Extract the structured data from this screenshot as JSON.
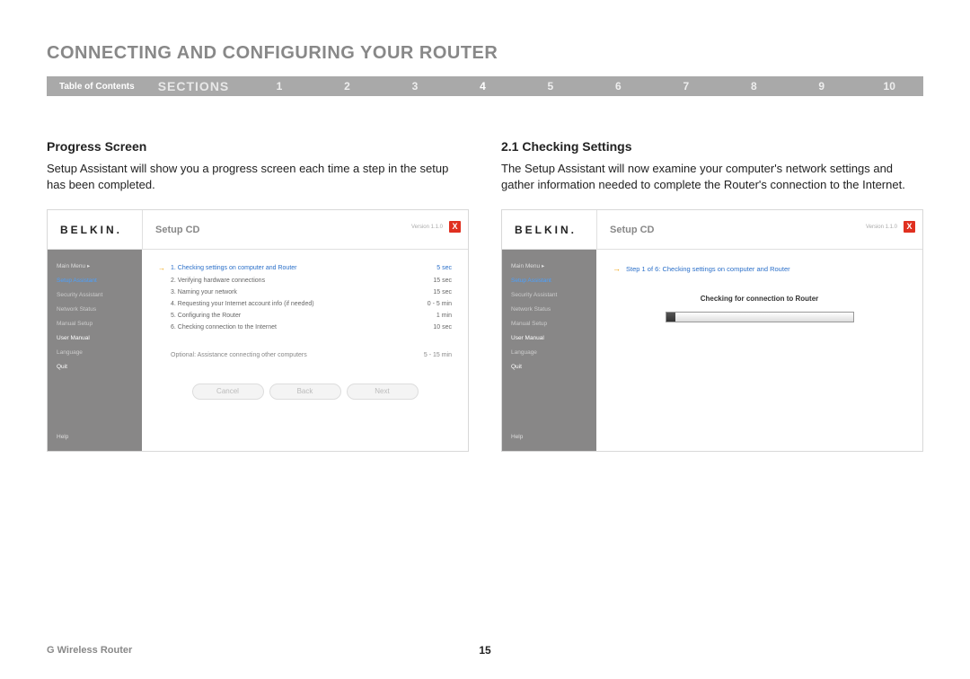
{
  "title": "CONNECTING AND CONFIGURING YOUR ROUTER",
  "navbar": {
    "toc": "Table of Contents",
    "sections": "SECTIONS",
    "nums": [
      "1",
      "2",
      "3",
      "4",
      "5",
      "6",
      "7",
      "8",
      "9",
      "10"
    ],
    "active": "4"
  },
  "left": {
    "heading": "Progress Screen",
    "body": "Setup Assistant will show you a progress screen each time a step in the setup has been completed."
  },
  "right": {
    "heading": "2.1 Checking Settings",
    "body": "The Setup Assistant will now examine your computer's network settings and gather information needed to complete the Router's connection to the Internet."
  },
  "screenshot": {
    "logo": "BELKIN.",
    "setupcd": "Setup CD",
    "version": "Version 1.1.0",
    "close": "X",
    "sidebar": {
      "main": "Main Menu  ▸",
      "items": [
        "Setup Assistant",
        "Security Assistant",
        "Network Status",
        "Manual Setup",
        "User Manual",
        "Language",
        "Quit"
      ],
      "help": "Help"
    },
    "steps": [
      {
        "n": "1.",
        "txt": "Checking settings on computer and Router",
        "time": "5 sec",
        "active": true
      },
      {
        "n": "2.",
        "txt": "Verifying hardware connections",
        "time": "15 sec"
      },
      {
        "n": "3.",
        "txt": "Naming your network",
        "time": "15 sec"
      },
      {
        "n": "4.",
        "txt": "Requesting your Internet account info (if needed)",
        "time": "0 - 5 min"
      },
      {
        "n": "5.",
        "txt": "Configuring the Router",
        "time": "1 min"
      },
      {
        "n": "6.",
        "txt": "Checking connection to the Internet",
        "time": "10 sec"
      }
    ],
    "optional": {
      "txt": "Optional: Assistance connecting other computers",
      "time": "5 - 15 min"
    },
    "buttons": {
      "cancel": "Cancel",
      "back": "Back",
      "next": "Next"
    }
  },
  "screenshot2": {
    "step_line": "Step 1 of 6: Checking settings on computer and Router",
    "checking": "Checking for connection to Router"
  },
  "footer": {
    "product": "G Wireless Router",
    "page": "15"
  }
}
